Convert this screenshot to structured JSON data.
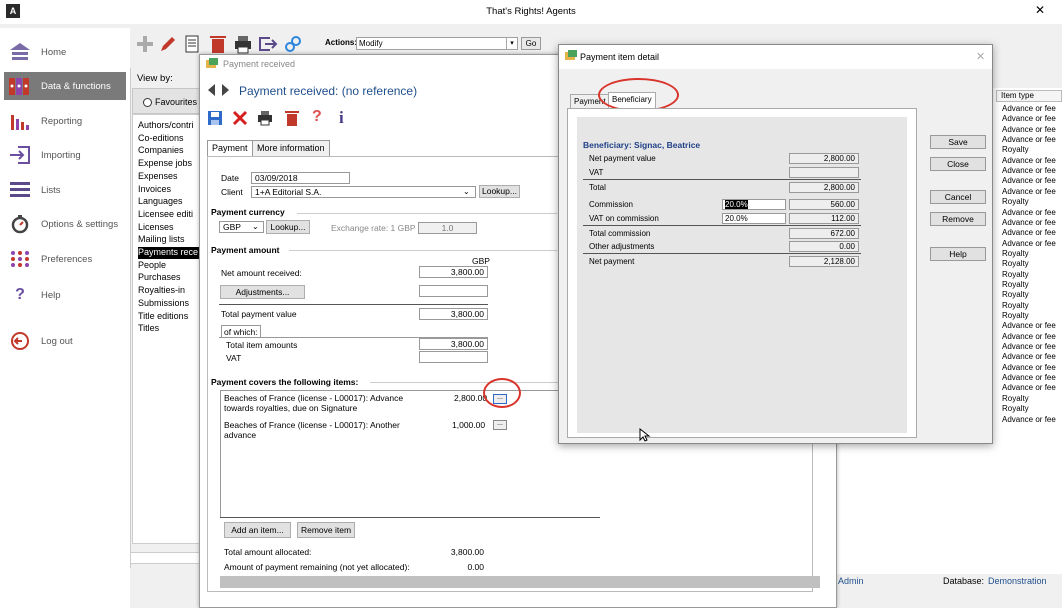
{
  "window": {
    "title": "That's Rights! Agents",
    "logo": "A",
    "close": "✕"
  },
  "nav": [
    {
      "label": "Home",
      "icon": "home-icon"
    },
    {
      "label": "Data & functions",
      "icon": "books-icon",
      "active": true
    },
    {
      "label": "Reporting",
      "icon": "bar-chart-icon"
    },
    {
      "label": "Importing",
      "icon": "import-icon"
    },
    {
      "label": "Lists",
      "icon": "list-icon"
    },
    {
      "label": "Options & settings",
      "icon": "stopwatch-icon"
    },
    {
      "label": "Preferences",
      "icon": "grid-dots-icon"
    },
    {
      "label": "Help",
      "icon": "help-icon"
    },
    {
      "label": "Log out",
      "icon": "logout-icon"
    }
  ],
  "toolbar": {
    "actions_label": "Actions:",
    "actions_value": "Modify",
    "go_label": "Go"
  },
  "viewby": {
    "label": "View by:",
    "favourites": "Favourites",
    "items": [
      "Authors/contri",
      "Co-editions",
      "Companies",
      "Expense jobs",
      "Expenses",
      "Invoices",
      "Languages",
      "Licensee editi",
      "Licenses",
      "Mailing lists",
      "Payments rece",
      "People",
      "Purchases",
      "Royalties-in",
      "Submissions",
      "Title editions",
      "Titles"
    ]
  },
  "grid": {
    "column": "Item type",
    "rows": [
      "Advance or fee",
      "Advance or fee",
      "Advance or fee",
      "Advance or fee",
      "Royalty",
      "Advance or fee",
      "Advance or fee",
      "Advance or fee",
      "Advance or fee",
      "Royalty",
      "Advance or fee",
      "Advance or fee",
      "Advance or fee",
      "Advance or fee",
      "Royalty",
      "Royalty",
      "Royalty",
      "Royalty",
      "Royalty",
      "Royalty",
      "Royalty",
      "Advance or fee",
      "Advance or fee",
      "Advance or fee",
      "Advance or fee",
      "Advance or fee",
      "Advance or fee",
      "Advance or fee",
      "Royalty",
      "Royalty",
      "Advance or fee"
    ]
  },
  "status": {
    "user": "Admin",
    "db_label": "Database:",
    "db_value": "Demonstration"
  },
  "payment": {
    "window_title": "Payment received",
    "heading": "Payment received: (no reference)",
    "tabs": [
      "Payment",
      "More information"
    ],
    "date_label": "Date",
    "date_value": "03/09/2018",
    "client_label": "Client",
    "client_value": "1+A Editorial S.A.",
    "lookup": "Lookup...",
    "currency_heading": "Payment currency",
    "currency_value": "GBP",
    "exchange_label": "Exchange rate: 1 GBP =",
    "exchange_value": "1.0",
    "amount_heading": "Payment amount",
    "gbp_label": "GBP",
    "net_amount_label": "Net amount received:",
    "net_amount_value": "3,800.00",
    "adjustments_button": "Adjustments...",
    "total_payment_label": "Total payment value",
    "total_payment_value": "3,800.00",
    "of_which": "of which:",
    "total_items_label": "Total item amounts",
    "total_items_value": "3,800.00",
    "vat_label": "VAT",
    "covers_heading": "Payment covers the following items:",
    "items": [
      {
        "line1": "Beaches of France (license - L00017):  Advance",
        "line2": "towards royalties, due on Signature",
        "amount": "2,800.00"
      },
      {
        "line1": "Beaches of France (license - L00017):  Another",
        "line2": "advance",
        "amount": "1,000.00"
      }
    ],
    "ellipsis": "...",
    "add_item": "Add an item...",
    "remove_item": "Remove item",
    "total_allocated_label": "Total amount allocated:",
    "total_allocated_value": "3,800.00",
    "remaining_label": "Amount of payment remaining (not yet allocated):",
    "remaining_value": "0.00"
  },
  "detail": {
    "title": "Payment item detail",
    "close": "✕",
    "tabs": [
      "Payment",
      "Beneficiary"
    ],
    "beneficiary": "Beneficiary: Signac, Beatrice",
    "net_payment_value_label": "Net payment value",
    "net_payment_value": "2,800.00",
    "vat_label": "VAT",
    "total_label": "Total",
    "total_value": "2,800.00",
    "commission_label": "Commission",
    "commission_pct": "20.0%",
    "commission_value": "560.00",
    "vat_comm_label": "VAT on commission",
    "vat_comm_pct": "20.0%",
    "vat_comm_value": "112.00",
    "total_comm_label": "Total commission",
    "total_comm_value": "672.00",
    "other_adj_label": "Other adjustments",
    "other_adj_value": "0.00",
    "net_payment_label": "Net payment",
    "net_payment": "2,128.00",
    "buttons": [
      "Save",
      "Close",
      "Cancel",
      "Remove",
      "Help"
    ]
  }
}
